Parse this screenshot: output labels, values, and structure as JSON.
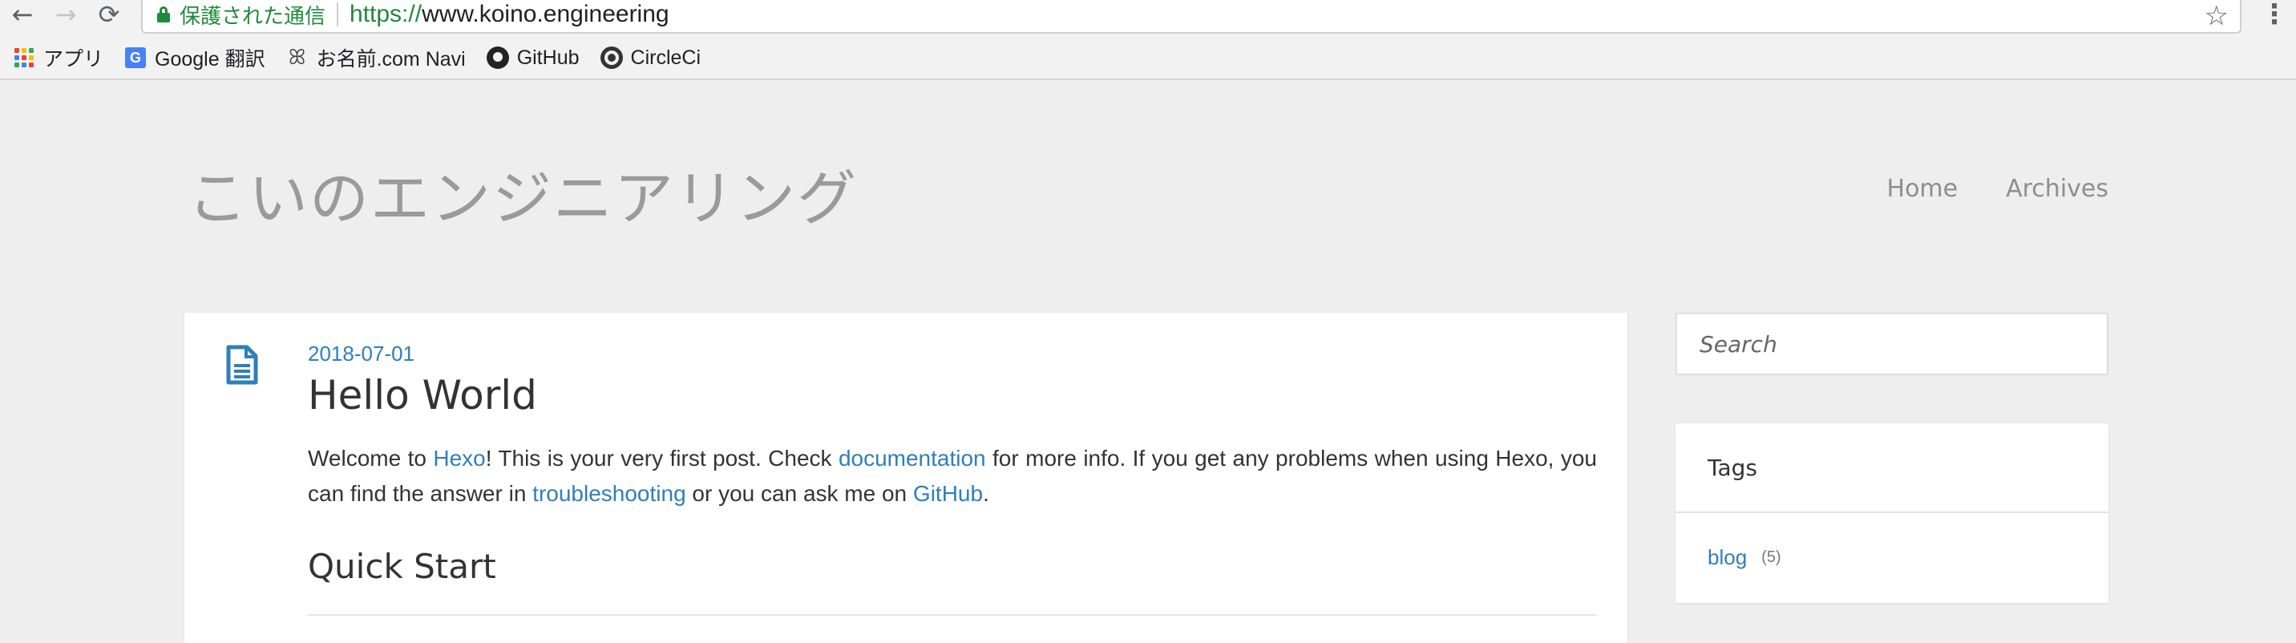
{
  "browser": {
    "nav": {
      "back": "←",
      "forward": "→",
      "reload": "⟳"
    },
    "address": {
      "security_label": "保護された通信",
      "url_scheme": "https://",
      "url_host": "www.koino.engineering",
      "bookmark_star": "☆"
    },
    "menu": "⋮",
    "bookmarks": [
      {
        "label": "アプリ",
        "icon": "apps-grid-icon"
      },
      {
        "label": "Google 翻訳",
        "icon": "google-translate-icon",
        "icon_text": "G"
      },
      {
        "label": "お名前.com Navi",
        "icon": "onamae-icon",
        "icon_text": "ꕤ"
      },
      {
        "label": "GitHub",
        "icon": "github-icon"
      },
      {
        "label": "CircleCi",
        "icon": "circleci-icon"
      }
    ],
    "apps_colors": [
      "#ea4335",
      "#fbbc05",
      "#34a853",
      "#4285f4",
      "#ea4335",
      "#fbbc05",
      "#34a853",
      "#4285f4",
      "#ea4335"
    ]
  },
  "site": {
    "title": "こいのエンジニアリング",
    "nav": [
      "Home",
      "Archives"
    ]
  },
  "post": {
    "date": "2018-07-01",
    "title": "Hello World",
    "body": {
      "t1": "Welcome to ",
      "link1": "Hexo",
      "t2": "! This is your very first post. Check ",
      "link2": "documentation",
      "t3": " for more info. If you get any problems when using Hexo, you can find the answer in ",
      "link3": "troubleshooting",
      "t4": " or you can ask me on ",
      "link4": "GitHub",
      "t5": "."
    },
    "section_heading": "Quick Start"
  },
  "sidebar": {
    "search_placeholder": "Search",
    "tags_title": "Tags",
    "tags": [
      {
        "name": "blog",
        "count": "(5)"
      }
    ]
  },
  "colors": {
    "link": "#2f7fb8",
    "secure": "#1e8a3a",
    "page_bg": "#eeeeee"
  }
}
